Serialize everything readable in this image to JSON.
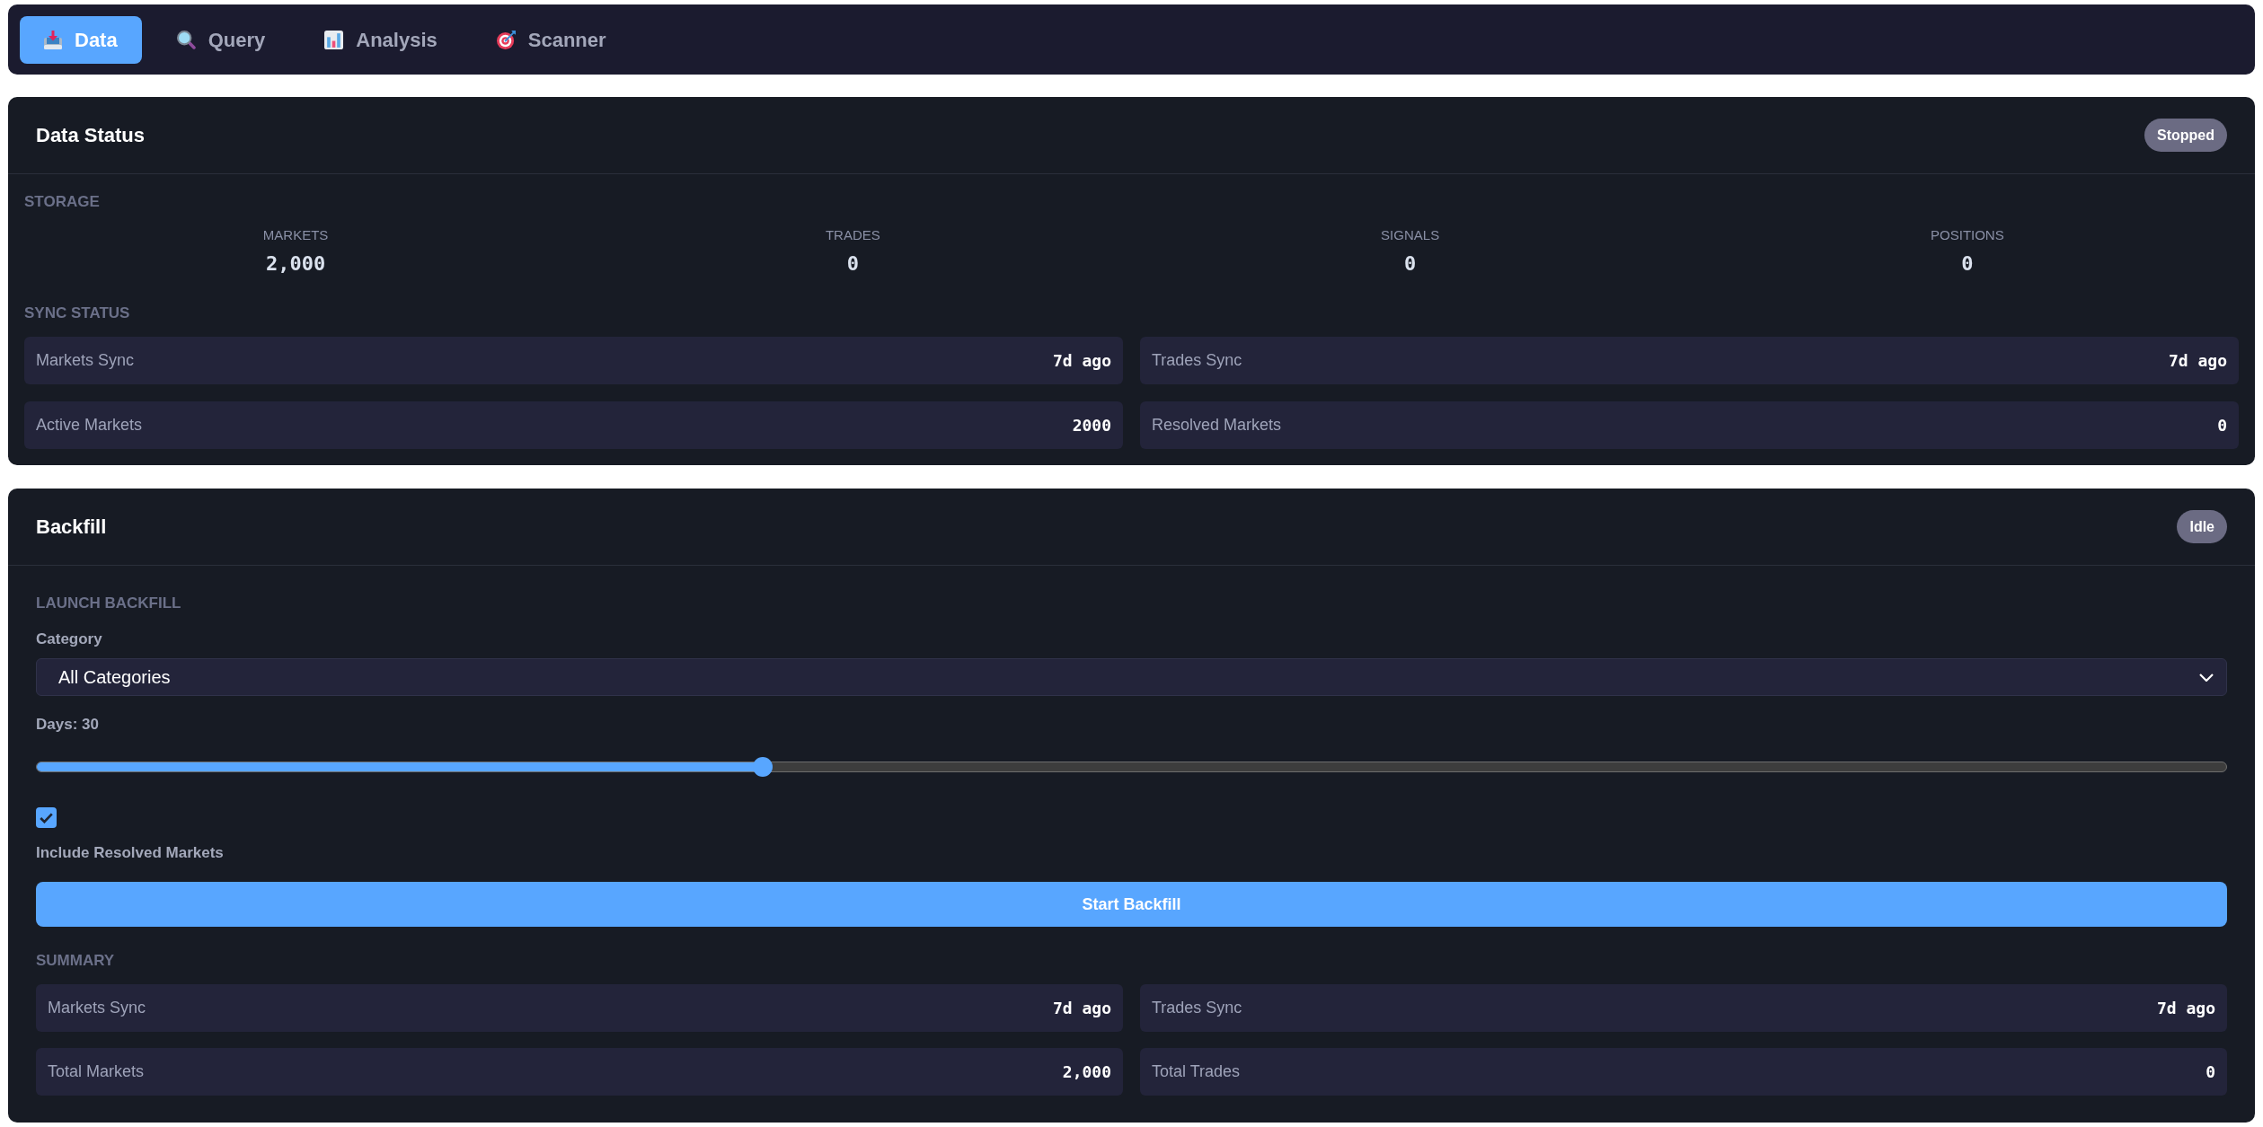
{
  "tabs": [
    {
      "label": "Data",
      "selected": true
    },
    {
      "label": "Query",
      "selected": false
    },
    {
      "label": "Analysis",
      "selected": false
    },
    {
      "label": "Scanner",
      "selected": false
    }
  ],
  "data_status": {
    "title": "Data Status",
    "badge": "Stopped",
    "storage_heading": "STORAGE",
    "storage": [
      {
        "label": "MARKETS",
        "value": "2,000"
      },
      {
        "label": "TRADES",
        "value": "0"
      },
      {
        "label": "SIGNALS",
        "value": "0"
      },
      {
        "label": "POSITIONS",
        "value": "0"
      }
    ],
    "sync_heading": "SYNC STATUS",
    "sync_rows": [
      {
        "label": "Markets Sync",
        "value": "7d ago"
      },
      {
        "label": "Trades Sync",
        "value": "7d ago"
      },
      {
        "label": "Active Markets",
        "value": "2000"
      },
      {
        "label": "Resolved Markets",
        "value": "0"
      }
    ]
  },
  "backfill": {
    "title": "Backfill",
    "badge": "Idle",
    "launch_heading": "LAUNCH BACKFILL",
    "category": {
      "label": "Category",
      "value": "All Categories"
    },
    "days": {
      "label": "Days: 30",
      "level": 0.33
    },
    "include_resolved": {
      "label": "Include Resolved Markets",
      "checked": true
    },
    "start_button": "Start Backfill",
    "summary_heading": "SUMMARY",
    "summary_rows": [
      {
        "label": "Markets Sync",
        "value": "7d ago"
      },
      {
        "label": "Trades Sync",
        "value": "7d ago"
      },
      {
        "label": "Total Markets",
        "value": "2,000"
      },
      {
        "label": "Total Trades",
        "value": "0"
      }
    ]
  }
}
